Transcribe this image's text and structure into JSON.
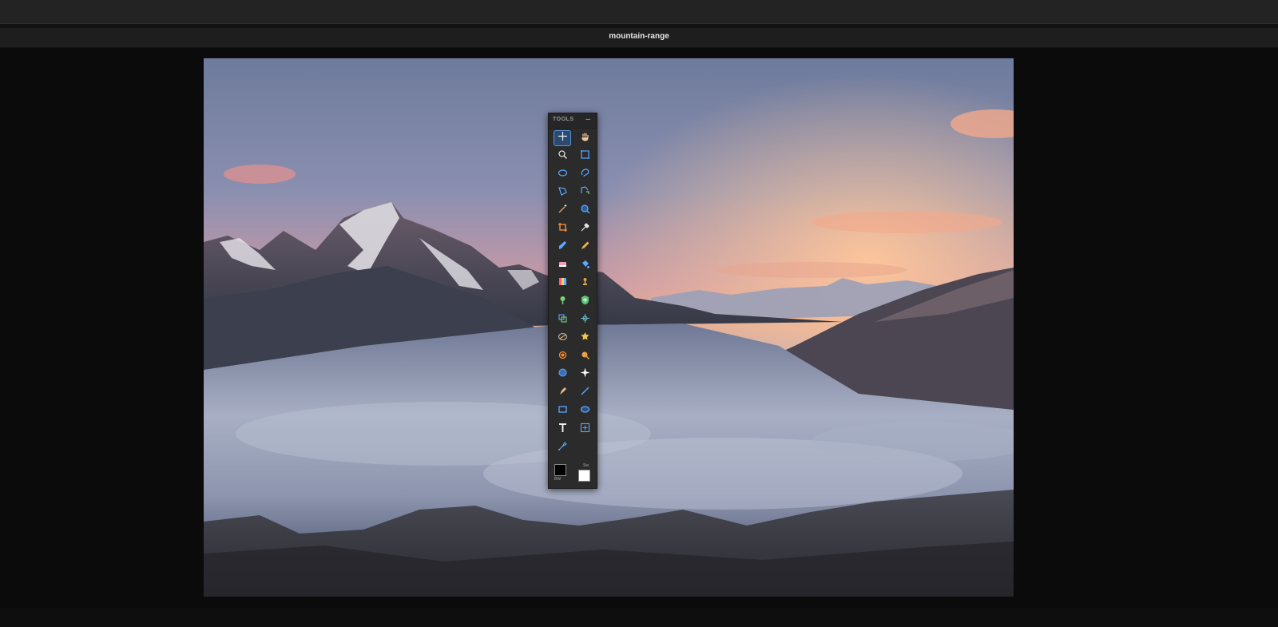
{
  "window": {
    "title": "mountain-range"
  },
  "tools_panel": {
    "title": "TOOLS",
    "minimize_label": "–",
    "swatch_left_label": "BW",
    "swatch_right_label": "Sw",
    "foreground_color": "#000000",
    "background_color": "#ffffff",
    "tools": [
      {
        "name": "move",
        "icon": "move-icon",
        "active": true
      },
      {
        "name": "hand",
        "icon": "hand-icon"
      },
      {
        "name": "zoom",
        "icon": "zoom-icon"
      },
      {
        "name": "rect-select",
        "icon": "rect-select-icon"
      },
      {
        "name": "ellipse-select",
        "icon": "ellipse-select-icon"
      },
      {
        "name": "lasso",
        "icon": "lasso-icon"
      },
      {
        "name": "polygon-lasso",
        "icon": "polygon-lasso-icon"
      },
      {
        "name": "magnetic-lasso",
        "icon": "magnetic-lasso-icon"
      },
      {
        "name": "magic-wand",
        "icon": "magic-wand-icon"
      },
      {
        "name": "quick-select",
        "icon": "quick-select-icon"
      },
      {
        "name": "crop",
        "icon": "crop-icon"
      },
      {
        "name": "eyedropper",
        "icon": "eyedropper-icon"
      },
      {
        "name": "brush",
        "icon": "brush-icon"
      },
      {
        "name": "pencil",
        "icon": "pencil-icon"
      },
      {
        "name": "eraser",
        "icon": "eraser-icon"
      },
      {
        "name": "paint-bucket",
        "icon": "paint-bucket-icon"
      },
      {
        "name": "gradient",
        "icon": "gradient-icon"
      },
      {
        "name": "clone-stamp",
        "icon": "clone-stamp-icon"
      },
      {
        "name": "healing",
        "icon": "healing-icon"
      },
      {
        "name": "patch",
        "icon": "patch-icon"
      },
      {
        "name": "transform",
        "icon": "transform-icon"
      },
      {
        "name": "perspective",
        "icon": "perspective-icon"
      },
      {
        "name": "blur",
        "icon": "blur-icon"
      },
      {
        "name": "sharpen",
        "icon": "sharpen-icon"
      },
      {
        "name": "dodge",
        "icon": "dodge-icon"
      },
      {
        "name": "burn",
        "icon": "burn-icon"
      },
      {
        "name": "sponge",
        "icon": "sponge-icon"
      },
      {
        "name": "sparkle",
        "icon": "sparkle-icon"
      },
      {
        "name": "smudge",
        "icon": "smudge-icon"
      },
      {
        "name": "line",
        "icon": "line-icon"
      },
      {
        "name": "rectangle",
        "icon": "rectangle-icon"
      },
      {
        "name": "ellipse",
        "icon": "ellipse-icon"
      },
      {
        "name": "text",
        "icon": "text-icon"
      },
      {
        "name": "artboard",
        "icon": "artboard-icon"
      },
      {
        "name": "pen",
        "icon": "pen-icon"
      }
    ]
  }
}
